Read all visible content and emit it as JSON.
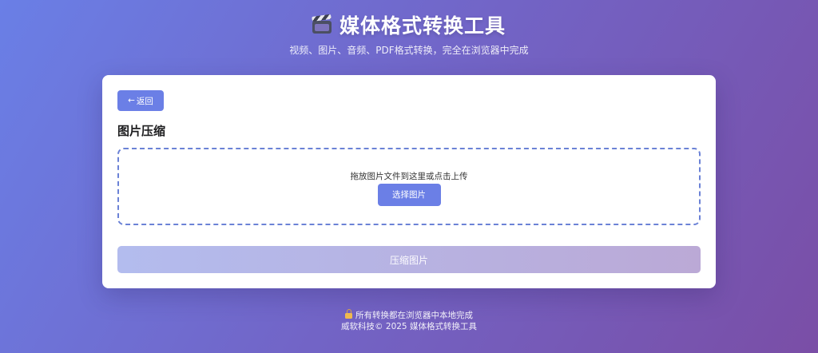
{
  "header": {
    "title": "媒体格式转换工具",
    "icon": "clapper-board-icon",
    "subtitle": "视频、图片、音频、PDF格式转换，完全在浏览器中完成"
  },
  "card": {
    "back_button": {
      "arrow": "←",
      "label": "返回"
    },
    "section_title": "图片压缩",
    "dropzone": {
      "prompt": "拖放图片文件到这里或点击上传",
      "select_button": "选择图片"
    },
    "compress_button": {
      "label": "压缩图片",
      "state": "disabled"
    }
  },
  "footer": {
    "lock_icon": "lock-icon",
    "privacy_note": "所有转换都在浏览器中本地完成",
    "copyright": "威软科技© 2025 媒体格式转换工具"
  },
  "colors": {
    "accent": "#6b7fe6",
    "background_start": "#6a7fe6",
    "background_end": "#7a4ea6",
    "dropzone_border": "#6b82d6"
  }
}
